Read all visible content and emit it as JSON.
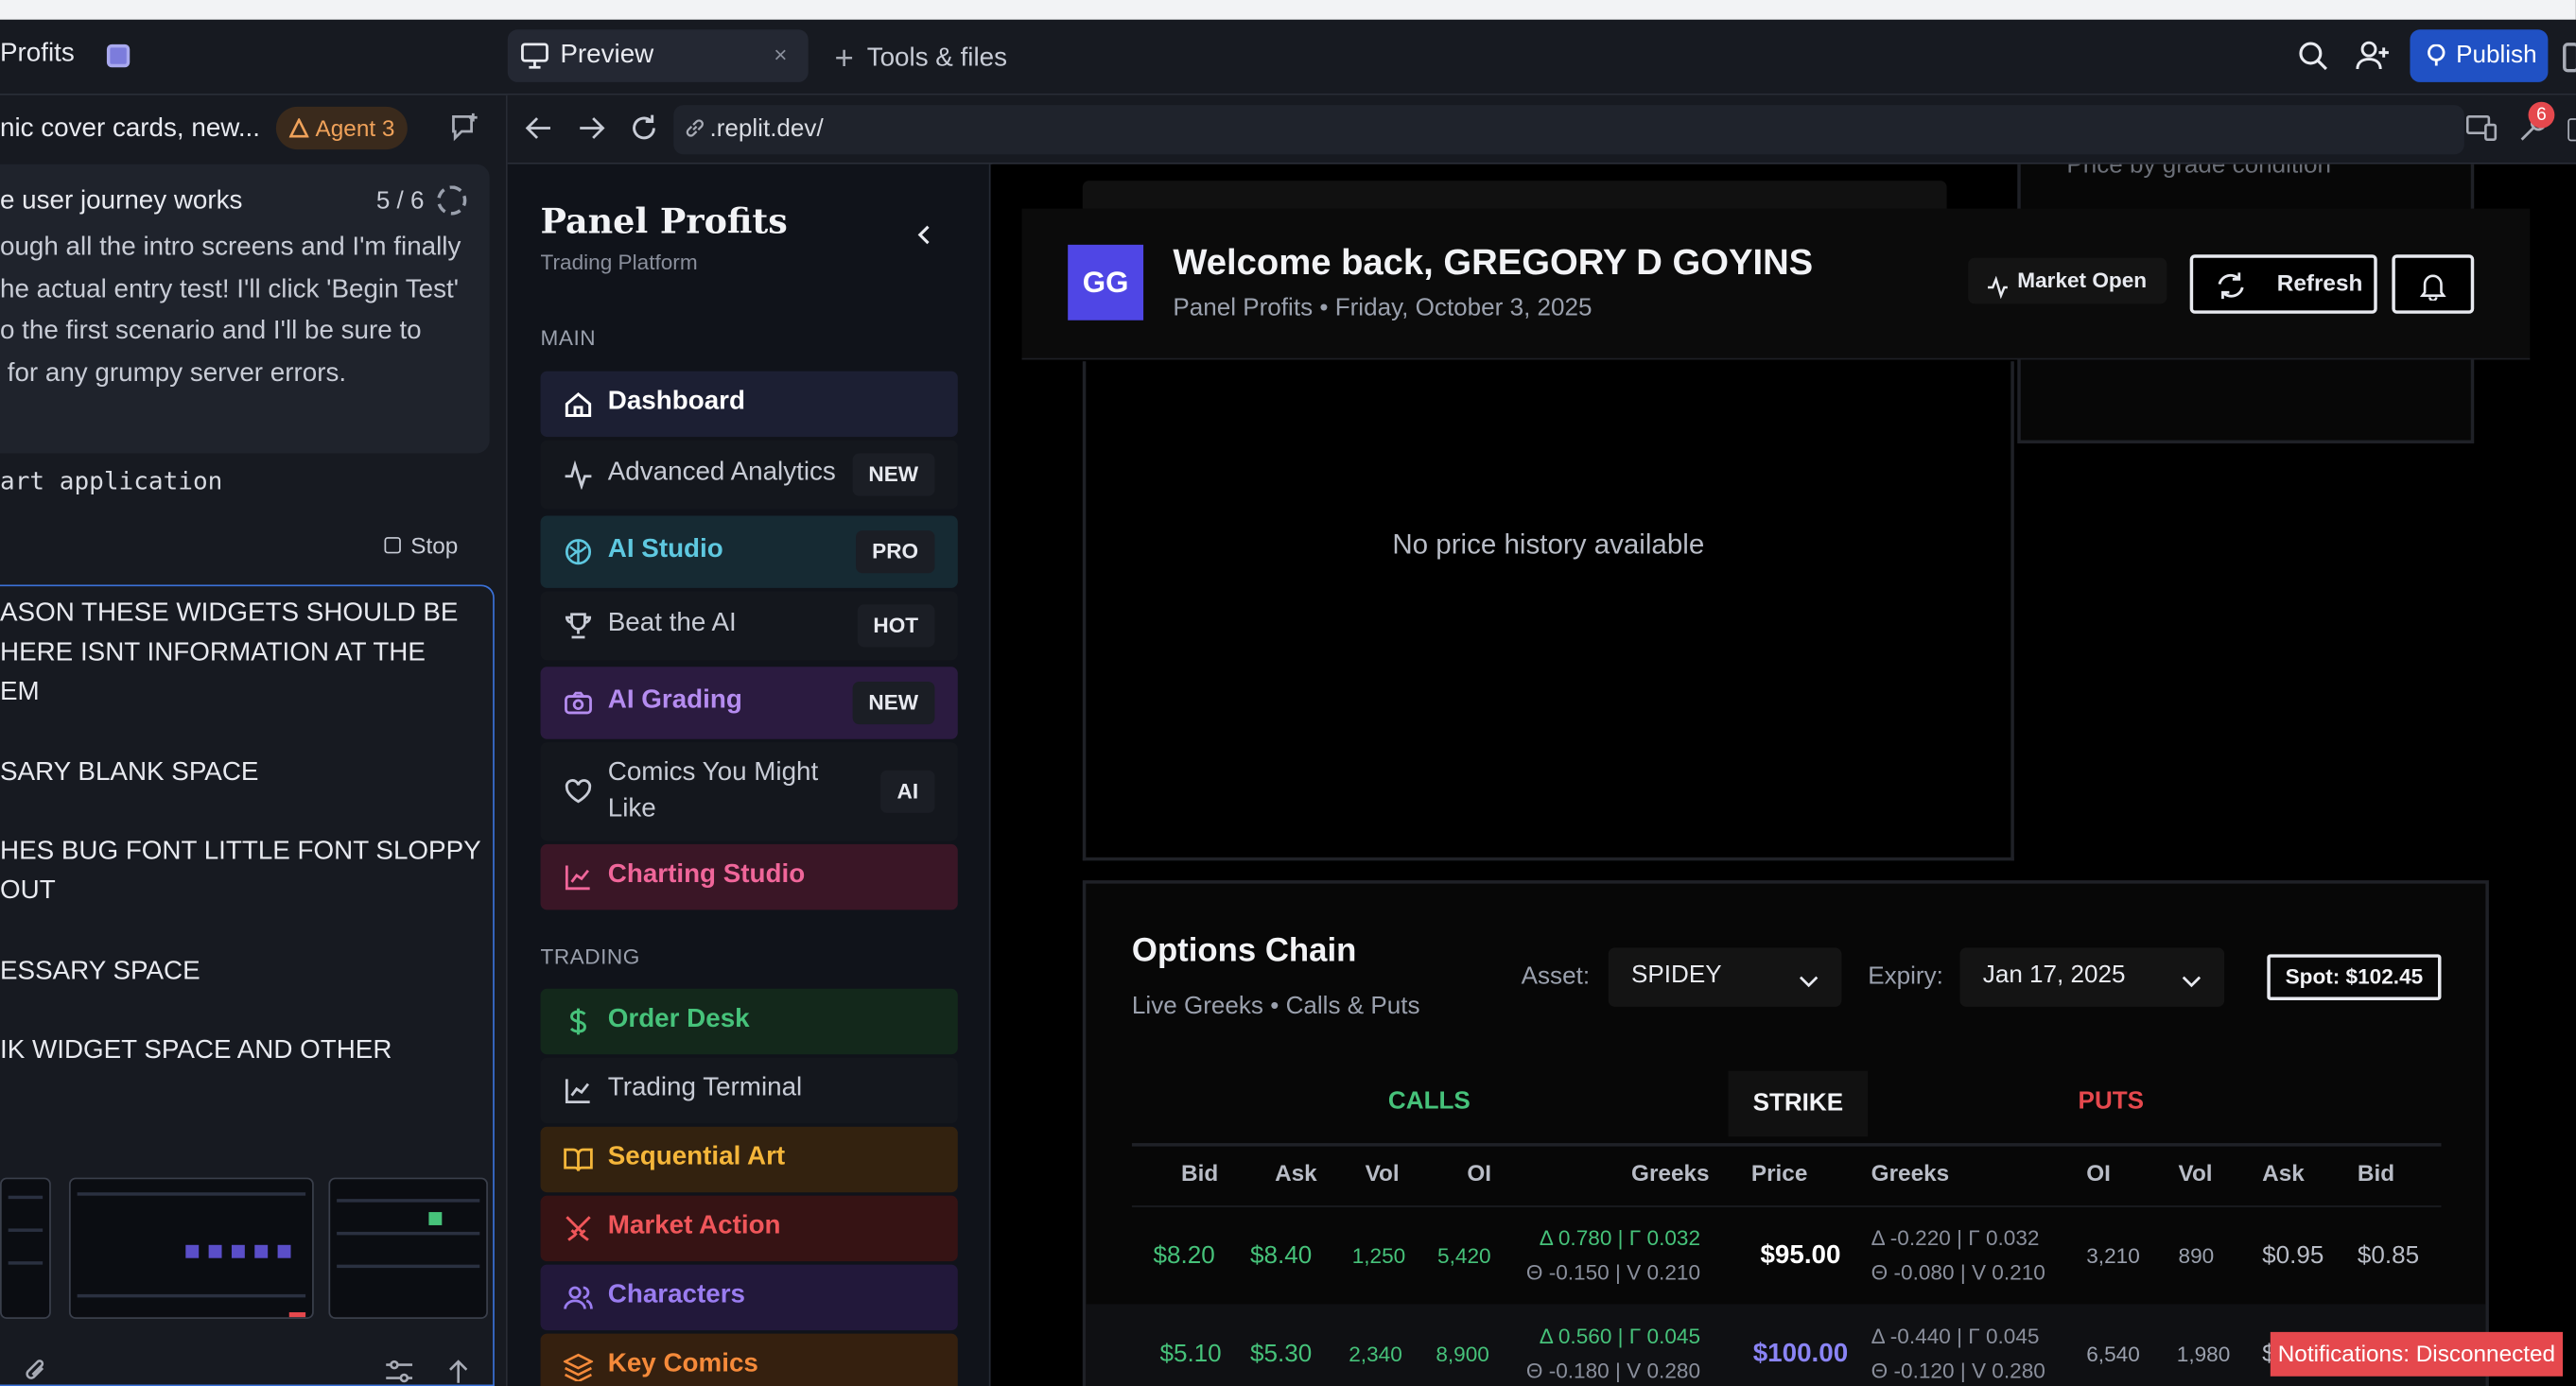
{
  "topbar": {
    "project_title": "Profits",
    "preview_tab": "Preview",
    "close_glyph": "×",
    "tools_tab": "Tools & files",
    "publish_label": "Publish"
  },
  "chat": {
    "title": "nic cover cards, new...",
    "agent_label": "Agent 3",
    "step_title": "e user journey works",
    "step_count": "5 / 6",
    "step_text": "ough all the intro screens and I'm finally\nhe actual entry test! I'll click 'Begin Test'\no the first scenario and I'll be sure to\n for any grumpy server errors.",
    "restart_label": "art application",
    "stop_label": "Stop",
    "message_lines": [
      "ASON THESE WIDGETS SHOULD BE",
      "HERE ISNT INFORMATION AT THE",
      "EM",
      "SARY BLANK SPACE",
      "HES BUG FONT LITTLE FONT SLOPPY",
      "OUT",
      "ESSARY SPACE",
      "IK WIDGET SPACE AND OTHER"
    ]
  },
  "browser": {
    "url": ".replit.dev/",
    "badge_count": "6"
  },
  "sidebar": {
    "brand": "Panel Profits",
    "brand_sub": "Trading Platform",
    "section_main": "MAIN",
    "section_trading": "TRADING",
    "items": [
      {
        "label": "Dashboard",
        "tag": "",
        "icon": "home-icon",
        "color": "#ffffff",
        "bg": "#1c1f33"
      },
      {
        "label": "Advanced Analytics",
        "tag": "NEW",
        "icon": "activity-icon",
        "color": "#c8ccd6",
        "bg": "#14171d"
      },
      {
        "label": "AI Studio",
        "tag": "PRO",
        "icon": "brain-icon",
        "color": "#5ec8e0",
        "bg": "#162a33"
      },
      {
        "label": "Beat the AI",
        "tag": "HOT",
        "icon": "trophy-icon",
        "color": "#c8ccd6",
        "bg": "#14171d"
      },
      {
        "label": "AI Grading",
        "tag": "NEW",
        "icon": "camera-icon",
        "color": "#b58cf0",
        "bg": "#2b1b40"
      },
      {
        "label": "Comics You Might Like",
        "tag": "AI",
        "icon": "heart-icon",
        "color": "#c8ccd6",
        "bg": "#14171d"
      },
      {
        "label": "Charting Studio",
        "tag": "",
        "icon": "chart-line-icon",
        "color": "#f0669a",
        "bg": "#3a1626"
      },
      {
        "label": "Order Desk",
        "tag": "",
        "icon": "dollar-icon",
        "color": "#46c27a",
        "bg": "#13281b"
      },
      {
        "label": "Trading Terminal",
        "tag": "",
        "icon": "chart-line-icon",
        "color": "#c8ccd6",
        "bg": "#14171d"
      },
      {
        "label": "Sequential Art",
        "tag": "",
        "icon": "book-icon",
        "color": "#f5b63a",
        "bg": "#33220f"
      },
      {
        "label": "Market Action",
        "tag": "",
        "icon": "swords-icon",
        "color": "#f0565a",
        "bg": "#361314"
      },
      {
        "label": "Characters",
        "tag": "",
        "icon": "users-icon",
        "color": "#9a7cf0",
        "bg": "#22183a"
      },
      {
        "label": "Key Comics",
        "tag": "",
        "icon": "layers-icon",
        "color": "#f58a3a",
        "bg": "#35200f"
      }
    ]
  },
  "welcome": {
    "avatar": "GG",
    "title": "Welcome back, GREGORY D GOYINS",
    "subtitle": "Panel Profits • Friday, October 3, 2025",
    "market_status": "Market Open",
    "refresh_label": "Refresh"
  },
  "behind": {
    "right_card_text": "Price by grade condition"
  },
  "price_history": {
    "empty_text": "No price history available"
  },
  "options": {
    "title": "Options Chain",
    "subtitle": "Live Greeks • Calls & Puts",
    "asset_label": "Asset:",
    "asset_value": "SPIDEY",
    "expiry_label": "Expiry:",
    "expiry_value": "Jan 17, 2025",
    "spot": "Spot: $102.45",
    "group_calls": "CALLS",
    "group_strike": "STRIKE",
    "group_puts": "PUTS",
    "columns": [
      "Bid",
      "Ask",
      "Vol",
      "OI",
      "Greeks",
      "Price",
      "Greeks",
      "OI",
      "Vol",
      "Ask",
      "Bid"
    ],
    "rows": [
      {
        "call_bid": "$8.20",
        "call_ask": "$8.40",
        "call_vol": "1,250",
        "call_oi": "5,420",
        "call_greeks_1": "Δ 0.780 | Γ 0.032",
        "call_greeks_2": "Θ -0.150 | V 0.210",
        "strike": "$95.00",
        "strike_color": "#ffffff",
        "put_greeks_1": "Δ -0.220 | Γ 0.032",
        "put_greeks_2": "Θ -0.080 | V 0.210",
        "put_oi": "3,210",
        "put_vol": "890",
        "put_ask": "$0.95",
        "put_bid": "$0.85"
      },
      {
        "call_bid": "$5.10",
        "call_ask": "$5.30",
        "call_vol": "2,340",
        "call_oi": "8,900",
        "call_greeks_1": "Δ 0.560 | Γ 0.045",
        "call_greeks_2": "Θ -0.180 | V 0.280",
        "strike": "$100.00",
        "strike_color": "#8a84f5",
        "put_greeks_1": "Δ -0.440 | Γ 0.045",
        "put_greeks_2": "Θ -0.120 | V 0.280",
        "put_oi": "6,540",
        "put_vol": "1,980",
        "put_ask": "$2",
        "put_bid": ""
      }
    ]
  },
  "toast": {
    "text": "Notifications: Disconnected"
  }
}
